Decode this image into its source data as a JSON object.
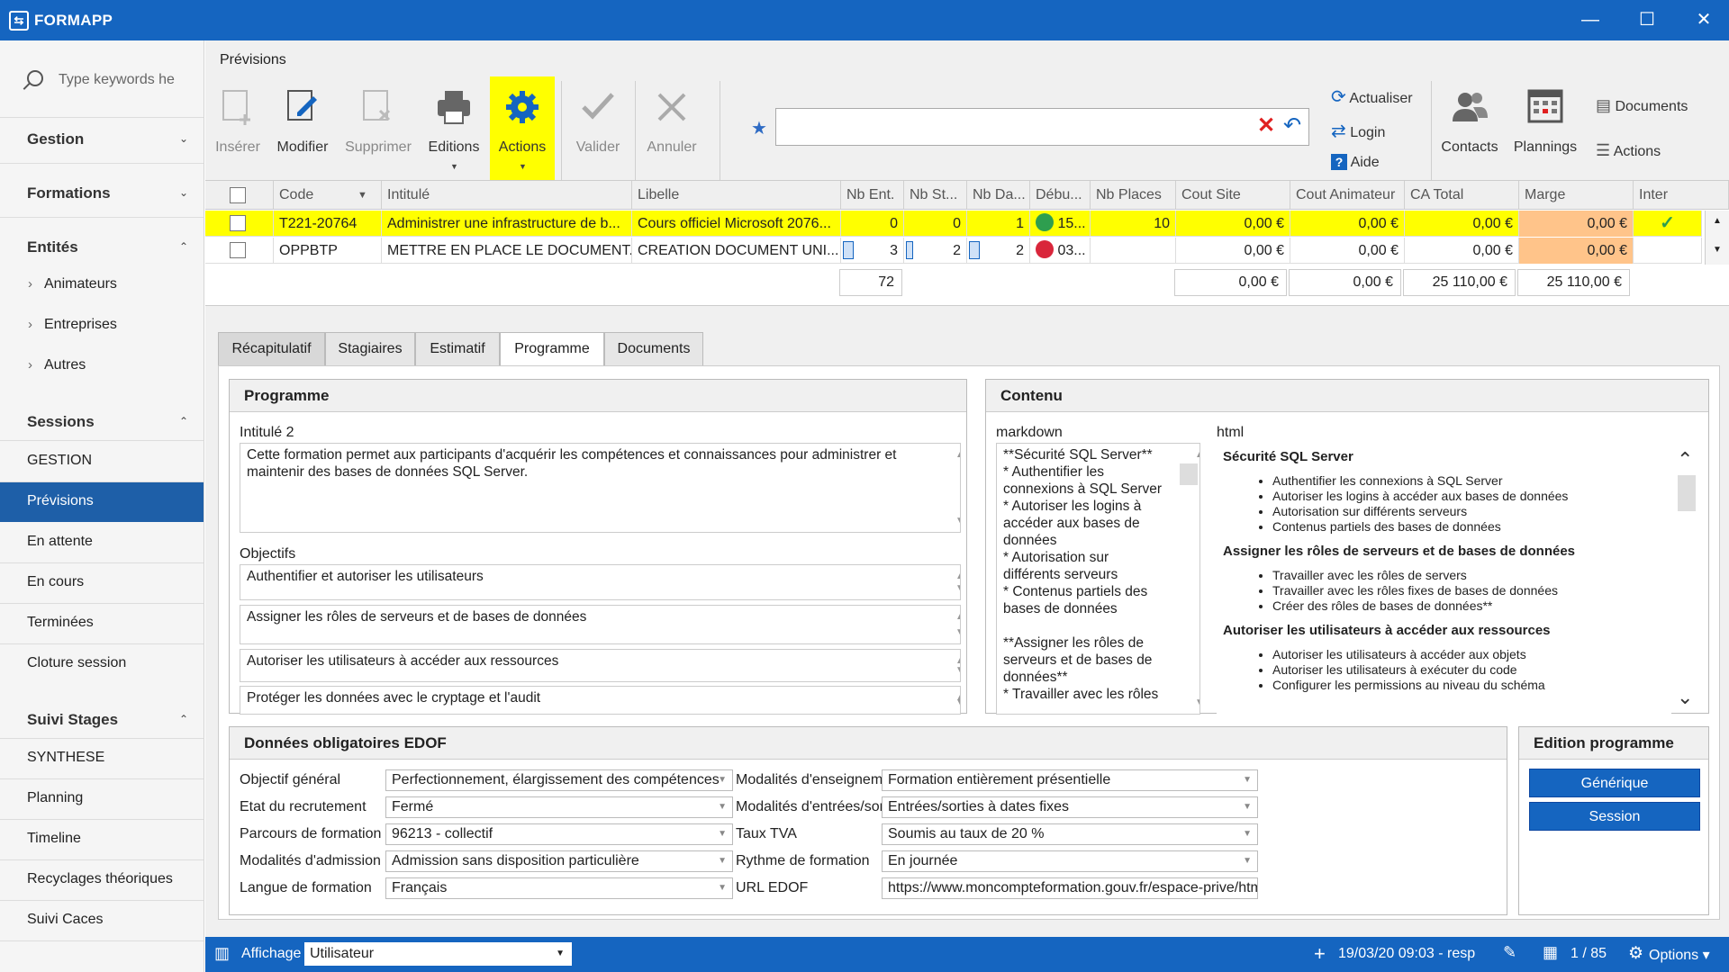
{
  "app": {
    "title": "FORMAPP",
    "logo_text": "⇆"
  },
  "window": {
    "minimize": "—",
    "maximize": "☐",
    "close": "✕"
  },
  "sidebar": {
    "search_placeholder": "Type keywords he",
    "sections": [
      {
        "label": "Gestion",
        "chevron": "⌄"
      },
      {
        "label": "Formations",
        "chevron": "⌄"
      },
      {
        "label": "Entités",
        "chevron": "⌃"
      },
      {
        "label": "Sessions",
        "chevron": "⌃"
      },
      {
        "label": "Suivi Stages",
        "chevron": "⌃"
      }
    ],
    "entites_items": [
      "Animateurs",
      "Entreprises",
      "Autres"
    ],
    "sessions_items": [
      "GESTION",
      "Prévisions",
      "En attente",
      "En cours",
      "Terminées",
      "Cloture session"
    ],
    "suivi_items": [
      "SYNTHESE",
      "Planning",
      "Timeline",
      "Recyclages théoriques",
      "Suivi Caces"
    ],
    "active": "Prévisions"
  },
  "main": {
    "title": "Prévisions"
  },
  "toolbar": {
    "insert": "Insérer",
    "modify": "Modifier",
    "delete": "Supprimer",
    "editions": "Editions",
    "actions": "Actions",
    "validate": "Valider",
    "cancel": "Annuler",
    "search_value": "",
    "refresh": "Actualiser",
    "login": "Login",
    "help": "Aide",
    "contacts": "Contacts",
    "plannings": "Plannings",
    "documents": "Documents",
    "actions2": "Actions"
  },
  "grid": {
    "headers": [
      "Code",
      "Intitulé",
      "Libelle",
      "Nb Ent.",
      "Nb St...",
      "Nb Da...",
      "Débu...",
      "Nb Places",
      "Cout Site",
      "Cout Animateur",
      "CA Total",
      "Marge",
      "Inter"
    ],
    "rows": [
      {
        "code": "T221-20764",
        "intitule": "Administrer une infrastructure de b...",
        "libelle": "Cours officiel Microsoft 2076...",
        "nb_ent": "0",
        "nb_st": "0",
        "nb_da": "1",
        "debut": "15...",
        "debut_color": "#2e9e4f",
        "nb_places": "10",
        "cout_site": "0,00 €",
        "cout_anim": "0,00 €",
        "ca_total": "0,00 €",
        "marge": "0,00 €",
        "inter": "✓"
      },
      {
        "code": "OPPBTP",
        "intitule": "METTRE EN PLACE LE DOCUMENT...",
        "libelle": "CREATION DOCUMENT UNI...",
        "nb_ent": "3",
        "nb_st": "2",
        "nb_da": "2",
        "debut": "03...",
        "debut_color": "#d9263b",
        "nb_places": "",
        "cout_site": "0,00 €",
        "cout_anim": "0,00 €",
        "ca_total": "0,00 €",
        "marge": "0,00 €",
        "inter": ""
      }
    ],
    "totals": {
      "nb_ent": "72",
      "cout_site": "0,00 €",
      "cout_anim": "0,00 €",
      "ca_total": "25 110,00 €",
      "marge": "25 110,00 €"
    },
    "colors": {
      "highlight": "#ffff00",
      "marge_warn": "#ffc48a"
    }
  },
  "tabs": [
    "Récapitulatif",
    "Stagiaires",
    "Estimatif",
    "Programme",
    "Documents"
  ],
  "programme": {
    "title": "Programme",
    "intitule_label": "Intitulé 2",
    "intitule_value": "Cette formation permet aux participants d'acquérir les compétences et connaissances pour administrer et maintenir des bases de données SQL Server.",
    "objectifs_label": "Objectifs",
    "objectifs": [
      "Authentifier et autoriser les utilisateurs",
      "Assigner les rôles de serveurs et de bases de données",
      "Autoriser les utilisateurs à accéder aux ressources",
      "Protéger les données avec le cryptage et l'audit"
    ]
  },
  "contenu": {
    "title": "Contenu",
    "markdown_label": "markdown",
    "html_label": "html",
    "markdown_lines": [
      "**Sécurité SQL Server**",
      "* Authentifier les",
      "connexions à SQL Server",
      "* Autoriser les logins à",
      "accéder aux bases de",
      "données",
      "* Autorisation sur",
      "différents serveurs",
      "* Contenus partiels des",
      "bases de données",
      "",
      "**Assigner les rôles de",
      "serveurs et de bases de",
      "données**",
      "* Travailler avec les rôles"
    ],
    "html_sections": [
      {
        "heading": "Sécurité SQL Server",
        "items": [
          "Authentifier les connexions à SQL Server",
          "Autoriser les logins à accéder aux bases de données",
          "Autorisation sur différents serveurs",
          "Contenus partiels des bases de données"
        ]
      },
      {
        "heading": "Assigner les rôles de serveurs et de bases de données",
        "items": [
          "Travailler avec les rôles de servers",
          "Travailler avec les rôles fixes de bases de données",
          "Créer des rôles de bases de données**"
        ]
      },
      {
        "heading": "Autoriser les utilisateurs à accéder aux ressources",
        "items": [
          "Autoriser les utilisateurs à accéder aux objets",
          "Autoriser les utilisateurs à exécuter du code",
          "Configurer les permissions au niveau du schéma"
        ]
      }
    ]
  },
  "edof": {
    "title": "Données obligatoires EDOF",
    "left": [
      {
        "label": "Objectif général",
        "value": "Perfectionnement, élargissement des compétences"
      },
      {
        "label": "Etat du recrutement",
        "value": "Fermé"
      },
      {
        "label": "Parcours de formation",
        "value": "96213 - collectif"
      },
      {
        "label": "Modalités d'admission",
        "value": "Admission sans disposition particulière"
      },
      {
        "label": "Langue de formation",
        "value": "Français"
      }
    ],
    "right": [
      {
        "label": "Modalités d'enseignement",
        "value": "Formation entièrement présentielle"
      },
      {
        "label": "Modalités d'entrées/sorties",
        "value": "Entrées/sorties à dates fixes"
      },
      {
        "label": "Taux TVA",
        "value": "Soumis au taux de 20 %"
      },
      {
        "label": "Rythme de formation",
        "value": "En journée"
      },
      {
        "label": "URL EDOF",
        "value": "https://www.moncompteformation.gouv.fr/espace-prive/html/#/for..."
      }
    ]
  },
  "edition": {
    "title": "Edition programme",
    "generic": "Générique",
    "session": "Session"
  },
  "status": {
    "affichage_label": "Affichage",
    "affichage_value": "Utilisateur",
    "timestamp": "19/03/20 09:03 - resp",
    "pages": "1 / 85",
    "options": "Options"
  }
}
